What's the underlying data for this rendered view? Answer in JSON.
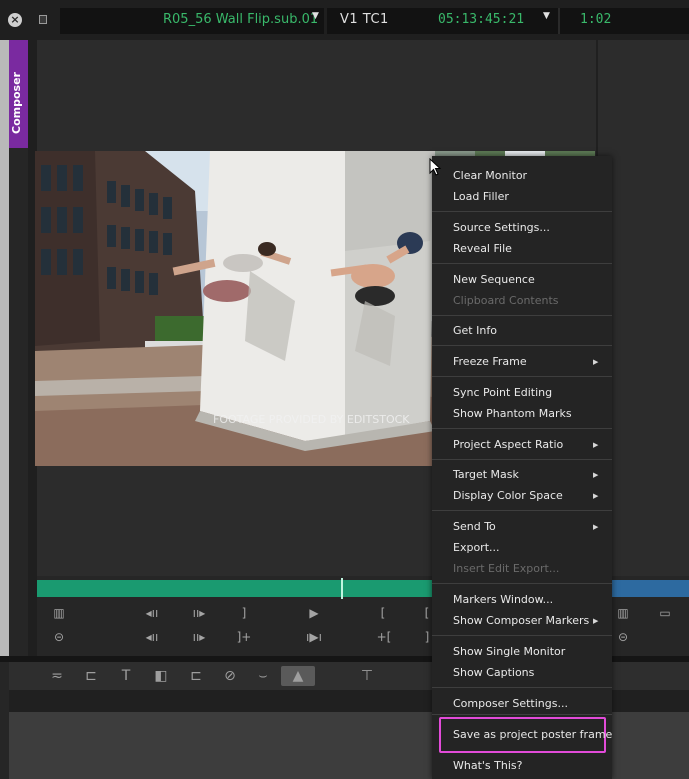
{
  "header": {
    "close_glyph": "×",
    "clip_name": "R05_56 Wall Flip.sub.01",
    "clip_dropdown_glyph": "▼",
    "track": "V1  TC1",
    "timecode": "05:13:45:21",
    "timecode_dropdown_glyph": "▼",
    "duration": "1:02"
  },
  "composer_tab": {
    "label": "Composer"
  },
  "frame": {
    "watermark": "FOOTAGE PROVIDED BY EDITSTOCK"
  },
  "transport": {
    "row1": [
      "▥",
      "◂ıı",
      "ıı▸",
      "]",
      "▶",
      "[",
      "[",
      "▥",
      "▭"
    ],
    "row2": [
      "⊝",
      "◂ıı",
      "ıı▸",
      "]+",
      "ı▶ı",
      "+[",
      "]",
      "⊝"
    ]
  },
  "toolbar": {
    "tools": [
      "≂",
      "⊏",
      "T",
      "◧",
      "⊏",
      "⊘",
      "⌣",
      "▲",
      "⊤"
    ]
  },
  "context_menu": {
    "items": [
      {
        "label": "Clear Monitor",
        "enabled": true,
        "submenu": false
      },
      {
        "label": "Load Filler",
        "enabled": true,
        "submenu": false
      },
      {
        "label": "Source Settings...",
        "enabled": true,
        "submenu": false
      },
      {
        "label": "Reveal File",
        "enabled": true,
        "submenu": false
      },
      {
        "label": "New Sequence",
        "enabled": true,
        "submenu": false
      },
      {
        "label": "Clipboard Contents",
        "enabled": false,
        "submenu": false
      },
      {
        "label": "Get Info",
        "enabled": true,
        "submenu": false
      },
      {
        "label": "Freeze Frame",
        "enabled": true,
        "submenu": true
      },
      {
        "label": "Sync Point Editing",
        "enabled": true,
        "submenu": false
      },
      {
        "label": "Show Phantom Marks",
        "enabled": true,
        "submenu": false
      },
      {
        "label": "Project Aspect Ratio",
        "enabled": true,
        "submenu": true
      },
      {
        "label": "Target Mask",
        "enabled": true,
        "submenu": true
      },
      {
        "label": "Display Color Space",
        "enabled": true,
        "submenu": true
      },
      {
        "label": "Send To",
        "enabled": true,
        "submenu": true
      },
      {
        "label": "Export...",
        "enabled": true,
        "submenu": false
      },
      {
        "label": "Insert Edit Export...",
        "enabled": false,
        "submenu": false
      },
      {
        "label": "Markers Window...",
        "enabled": true,
        "submenu": false
      },
      {
        "label": "Show Composer Markers",
        "enabled": true,
        "submenu": true
      },
      {
        "label": "Show Single Monitor",
        "enabled": true,
        "submenu": false
      },
      {
        "label": "Show Captions",
        "enabled": true,
        "submenu": false
      },
      {
        "label": "Composer Settings...",
        "enabled": true,
        "submenu": false
      },
      {
        "label": "Save as project poster frame",
        "enabled": true,
        "submenu": false,
        "highlighted": true
      },
      {
        "label": "What's This?",
        "enabled": true,
        "submenu": false
      }
    ],
    "submenu_glyph": "▶"
  },
  "colors": {
    "accent_green": "#39b86a",
    "composer_purple": "#7a2aa0",
    "timeline_teal": "#1a9a70",
    "highlight_magenta": "#e24bd9"
  }
}
